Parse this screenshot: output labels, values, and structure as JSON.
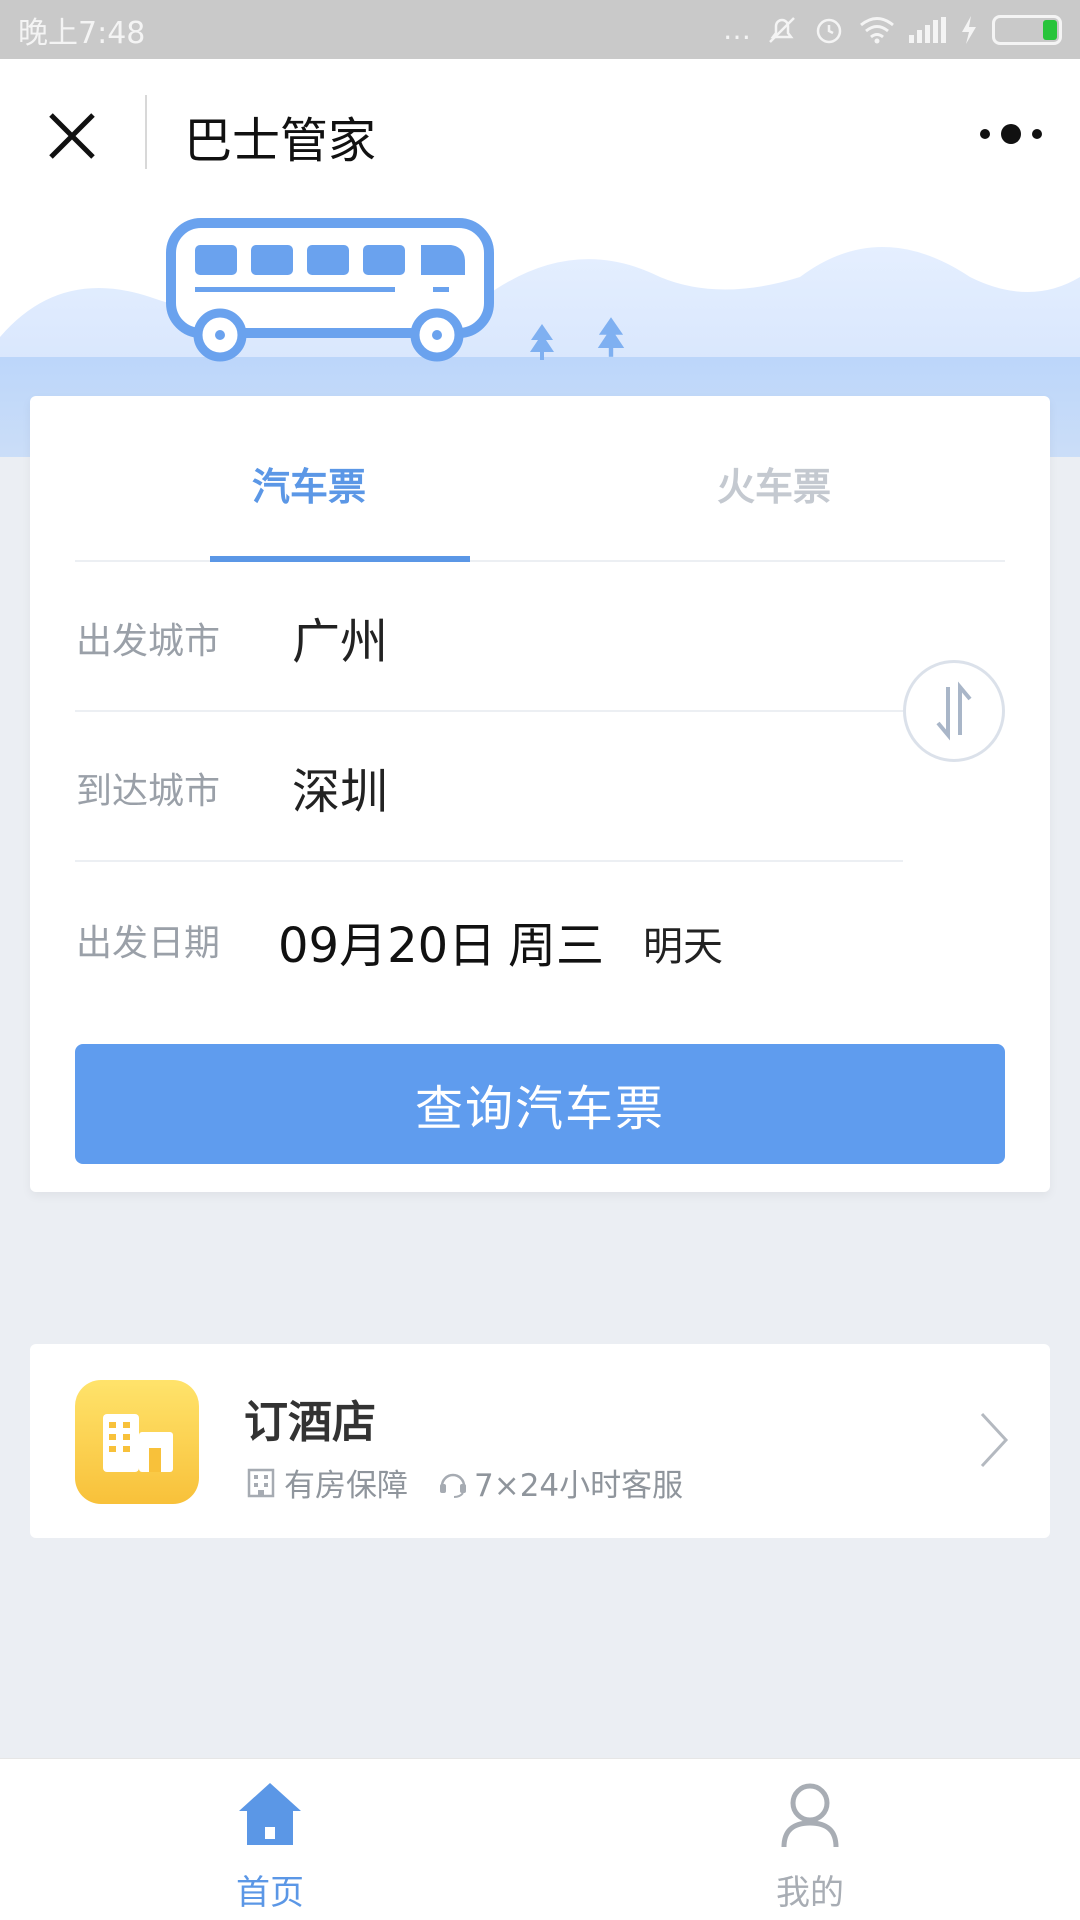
{
  "status_bar": {
    "time": "晚上7:48",
    "icons": [
      "more-dots-icon",
      "mute-icon",
      "alarm-icon",
      "wifi-icon",
      "signal-icon",
      "charging-icon",
      "battery-icon"
    ]
  },
  "nav": {
    "title": "巴士管家"
  },
  "tabs": [
    {
      "label": "汽车票",
      "active": true
    },
    {
      "label": "火车票",
      "active": false
    }
  ],
  "form": {
    "departure_label": "出发城市",
    "departure_value": "广州",
    "arrival_label": "到达城市",
    "arrival_value": "深圳",
    "date_label": "出发日期",
    "date_value": "09月20日",
    "weekday": "周三",
    "relative_day": "明天"
  },
  "search_button": "查询汽车票",
  "hotel": {
    "title": "订酒店",
    "tag1": "有房保障",
    "tag2": "7×24小时客服"
  },
  "tab_bar": {
    "home": "首页",
    "mine": "我的"
  },
  "colors": {
    "accent": "#5b97e6",
    "button": "#5f9cee",
    "hotel_icon": "#f8c13a",
    "inactive": "#c4c9d0"
  }
}
